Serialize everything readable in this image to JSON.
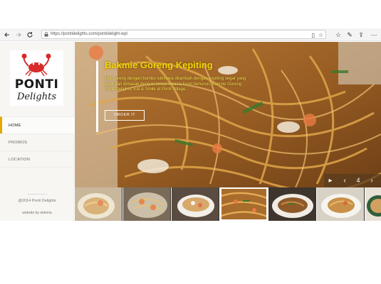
{
  "browser": {
    "url": "https://pontidelights.com/pontidelight-wp/",
    "icons": {
      "back": "back-arrow-icon",
      "forward": "forward-arrow-icon",
      "refresh": "refresh-icon",
      "lock": "lock-icon",
      "reading_view": "reading-view-icon",
      "favorite": "star-icon",
      "favorites_list": "favorites-icon",
      "notes": "pen-icon",
      "share": "share-icon",
      "more": "more-icon"
    }
  },
  "sidebar": {
    "logo": {
      "line1": "PONTI",
      "line2": "Delights"
    },
    "nav": [
      {
        "label": "HOME",
        "active": true
      },
      {
        "label": "PROMOS",
        "active": false
      },
      {
        "label": "LOCATION",
        "active": false
      }
    ],
    "copyright": "@2014 Ponti Delights",
    "credit": "website by eldema"
  },
  "hero": {
    "title": "Bakmie Goreng Kepiting",
    "description": "Mie goreng dengan bumbu istimewa ditambah dengan kepiting segar yang lezat dan dimasak dengan resep rahasia turun temurun. Bakmie Goreng Ponti Delights, Eat & Smile at Ponti Village.",
    "button": "ORDER IT",
    "slide_number": "4",
    "prev_symbol": "‹",
    "next_symbol": "›"
  },
  "thumbnails": [
    {
      "name": "noodle-soup"
    },
    {
      "name": "shrimp-noodles"
    },
    {
      "name": "soup-bowl"
    },
    {
      "name": "fried-noodles",
      "active": true
    },
    {
      "name": "kwetiau-plate"
    },
    {
      "name": "noodle-plate"
    },
    {
      "name": "noodle-bowl"
    }
  ],
  "colors": {
    "accent": "#e4a800",
    "title": "#f2d600",
    "sidebar_bg": "#f7f6f3"
  }
}
